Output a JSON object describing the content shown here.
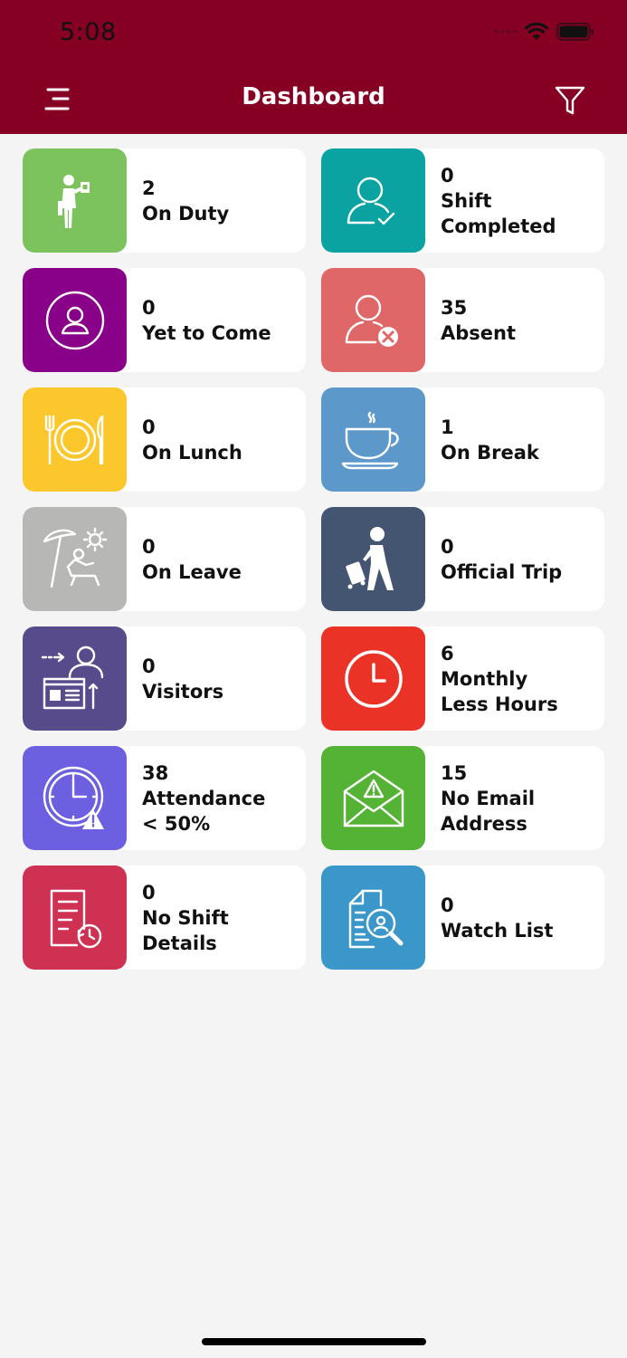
{
  "status_bar": {
    "time": "5:08"
  },
  "header": {
    "title": "Dashboard"
  },
  "cards": [
    {
      "count": "2",
      "line1": "On Duty",
      "line2": "",
      "icon": "duty-person-icon",
      "color": "#7cc35d"
    },
    {
      "count": "0",
      "line1": "Shift",
      "line2": "Completed",
      "icon": "user-check-icon",
      "color": "#0aa3a2"
    },
    {
      "count": "0",
      "line1": "Yet to Come",
      "line2": "",
      "icon": "user-circle-icon",
      "color": "#880188"
    },
    {
      "count": "35",
      "line1": "Absent",
      "line2": "",
      "icon": "user-x-icon",
      "color": "#e06767"
    },
    {
      "count": "0",
      "line1": "On Lunch",
      "line2": "",
      "icon": "plate-cutlery-icon",
      "color": "#fbc72c"
    },
    {
      "count": "1",
      "line1": "On Break",
      "line2": "",
      "icon": "coffee-cup-icon",
      "color": "#5d98cb"
    },
    {
      "count": "0",
      "line1": "On Leave",
      "line2": "",
      "icon": "beach-chair-icon",
      "color": "#b7b7b5"
    },
    {
      "count": "0",
      "line1": "Official Trip",
      "line2": "",
      "icon": "traveler-icon",
      "color": "#435570"
    },
    {
      "count": "0",
      "line1": "Visitors",
      "line2": "",
      "icon": "visitor-desk-icon",
      "color": "#574b8c"
    },
    {
      "count": "6",
      "line1": "Monthly",
      "line2": "Less Hours",
      "icon": "clock-icon",
      "color": "#ea3326"
    },
    {
      "count": "38",
      "line1": "Attendance",
      "line2": "< 50%",
      "icon": "clock-warning-icon",
      "color": "#6c5fe0"
    },
    {
      "count": "15",
      "line1": "No Email",
      "line2": "Address",
      "icon": "envelope-warning-icon",
      "color": "#54b335"
    },
    {
      "count": "0",
      "line1": "No Shift Details",
      "line2": "",
      "icon": "document-history-icon",
      "color": "#cf3152"
    },
    {
      "count": "0",
      "line1": "Watch List",
      "line2": "",
      "icon": "document-search-icon",
      "color": "#3b97c9"
    }
  ]
}
